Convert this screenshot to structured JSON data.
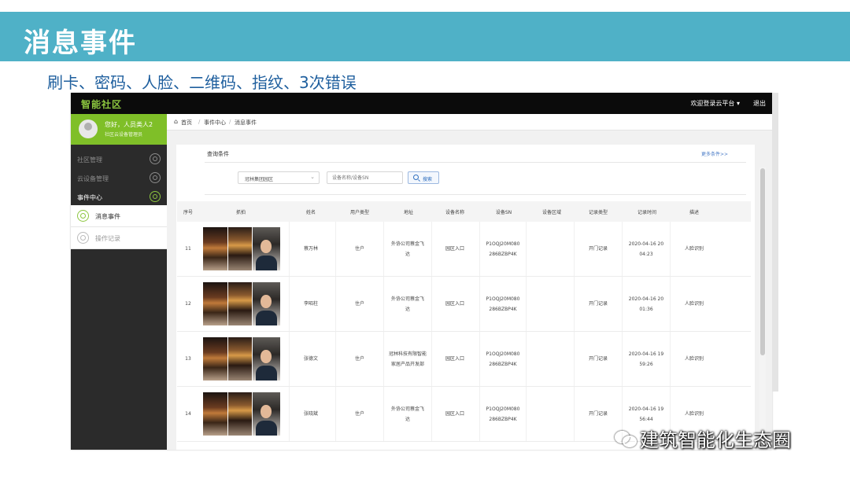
{
  "slide": {
    "title": "消息事件",
    "subtitle": "刷卡、密码、人脸、二维码、指纹、3次错误"
  },
  "app": {
    "logo": "智能社区",
    "welcome": "欢迎登录云平台 ▾",
    "logout": "退出"
  },
  "sidebar": {
    "user_name": "您好，人员类人2",
    "user_role": "社区云设备管理员",
    "items": [
      {
        "label": "社区管理"
      },
      {
        "label": "云设备管理"
      },
      {
        "label": "事件中心"
      }
    ],
    "sub_items": [
      {
        "label": "消息事件"
      },
      {
        "label": "操作记录"
      }
    ]
  },
  "breadcrumb": {
    "home": "首页",
    "sep": "/",
    "center": "事件中心",
    "current": "消息事件"
  },
  "query": {
    "title": "查询条件",
    "more": "更多条件>>",
    "select_value": "冠林集团园区",
    "input_placeholder": "设备名称/设备SN",
    "search_label": "搜索"
  },
  "table": {
    "headers": [
      "序号",
      "抓拍",
      "姓名",
      "用户类型",
      "地址",
      "设备名称",
      "设备SN",
      "设备区域",
      "记录类型",
      "记录时间",
      "描述"
    ],
    "rows": [
      {
        "index": "11",
        "name": "蔡万林",
        "user_type": "住户",
        "address": [
          "外协公司蔡金飞",
          "达"
        ],
        "device_name": "园区入口",
        "device_sn": [
          "P1OQJ20M080",
          "286BZBP4K"
        ],
        "device_area": "",
        "record_type": "开门记录",
        "record_time": [
          "2020-04-16 20",
          "04:23"
        ],
        "desc": "人脸识别"
      },
      {
        "index": "12",
        "name": "李昭柱",
        "user_type": "住户",
        "address": [
          "外协公司蔡金飞",
          "达"
        ],
        "device_name": "园区入口",
        "device_sn": [
          "P1OQJ20M080",
          "286BZBP4K"
        ],
        "device_area": "",
        "record_type": "开门记录",
        "record_time": [
          "2020-04-16 20",
          "01:36"
        ],
        "desc": "人脸识别"
      },
      {
        "index": "13",
        "name": "张德文",
        "user_type": "住户",
        "address": [
          "冠林科技有限智能",
          "家居产品开发部"
        ],
        "device_name": "园区入口",
        "device_sn": [
          "P1OQJ20M080",
          "286BZBP4K"
        ],
        "device_area": "",
        "record_type": "开门记录",
        "record_time": [
          "2020-04-16 19",
          "59:26"
        ],
        "desc": "人脸识别"
      },
      {
        "index": "14",
        "name": "张晓斌",
        "user_type": "住户",
        "address": [
          "外协公司蔡金飞",
          "达"
        ],
        "device_name": "园区入口",
        "device_sn": [
          "P1OQJ20M080",
          "286BZBP4K"
        ],
        "device_area": "",
        "record_type": "开门记录",
        "record_time": [
          "2020-04-16 19",
          "56:44"
        ],
        "desc": "人脸识别"
      }
    ]
  },
  "watermark": "建筑智能化生态圈",
  "colors": {
    "banner": "#4fb1c7",
    "accent_green": "#7fbf28",
    "sidebar_dark": "#2b2b2b",
    "topbar": "#0b0b0b"
  }
}
